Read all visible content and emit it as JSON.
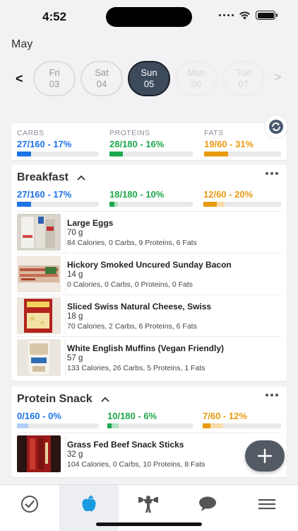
{
  "status_bar": {
    "time": "4:52"
  },
  "month": "May",
  "days": [
    {
      "name": "Fri",
      "num": "03",
      "state": "past"
    },
    {
      "name": "Sat",
      "num": "04",
      "state": "past"
    },
    {
      "name": "Sun",
      "num": "05",
      "state": "selected"
    },
    {
      "name": "Mon",
      "num": "06",
      "state": "future"
    },
    {
      "name": "Tue",
      "num": "07",
      "state": "future"
    }
  ],
  "summary": {
    "carbs": {
      "label": "CARBS",
      "value": "27/160 - 17%",
      "progress": 0.17
    },
    "proteins": {
      "label": "PROTEINS",
      "value": "28/180 - 16%",
      "progress": 0.16
    },
    "fats": {
      "label": "FATS",
      "value": "19/60 - 31%",
      "progress": 0.31
    }
  },
  "meals": [
    {
      "title": "Breakfast",
      "carbs": {
        "value": "27/160 - 17%",
        "progress": 0.17,
        "pending": 0
      },
      "proteins": {
        "value": "18/180 - 10%",
        "progress": 0.06,
        "pending": 0.04
      },
      "fats": {
        "value": "12/60 - 20%",
        "progress": 0.17,
        "pending": 0.1
      },
      "foods": [
        {
          "name": "Large Eggs",
          "qty": "70 g",
          "detail": "84 Calories, 0 Carbs, 9 Proteins, 6 Fats",
          "thumb": "eggs"
        },
        {
          "name": "Hickory Smoked Uncured Sunday Bacon",
          "qty": "14 g",
          "detail": "0 Calories, 0 Carbs, 0 Proteins, 0 Fats",
          "thumb": "bacon"
        },
        {
          "name": "Sliced Swiss Natural Cheese, Swiss",
          "qty": "18 g",
          "detail": "70 Calories, 2 Carbs, 6 Proteins, 6 Fats",
          "thumb": "cheese"
        },
        {
          "name": "White English Muffins (Vegan Friendly)",
          "qty": "57 g",
          "detail": "133 Calories, 26 Carbs, 5 Proteins, 1 Fats",
          "thumb": "muffins"
        }
      ]
    },
    {
      "title": "Protein Snack",
      "carbs": {
        "value": "0/160 - 0%",
        "progress": 0.0,
        "pending": 0.14
      },
      "proteins": {
        "value": "10/180 - 6%",
        "progress": 0.05,
        "pending": 0.08
      },
      "fats": {
        "value": "7/60 - 12%",
        "progress": 0.1,
        "pending": 0.16
      },
      "foods": [
        {
          "name": "Grass Fed Beef Snack Sticks",
          "qty": "32 g",
          "detail": "104 Calories, 0 Carbs, 10 Proteins, 8 Fats",
          "thumb": "sticks"
        }
      ]
    }
  ],
  "colors": {
    "carbs": "#1e73e8",
    "proteins": "#1ea84b",
    "fats": "#e89a10",
    "accent": "#1a9be0"
  },
  "tabs": [
    {
      "icon": "check-circle-icon",
      "active": false
    },
    {
      "icon": "apple-icon",
      "active": true
    },
    {
      "icon": "weightlifter-icon",
      "active": false
    },
    {
      "icon": "chat-bubble-icon",
      "active": false
    },
    {
      "icon": "menu-icon",
      "active": false
    }
  ]
}
